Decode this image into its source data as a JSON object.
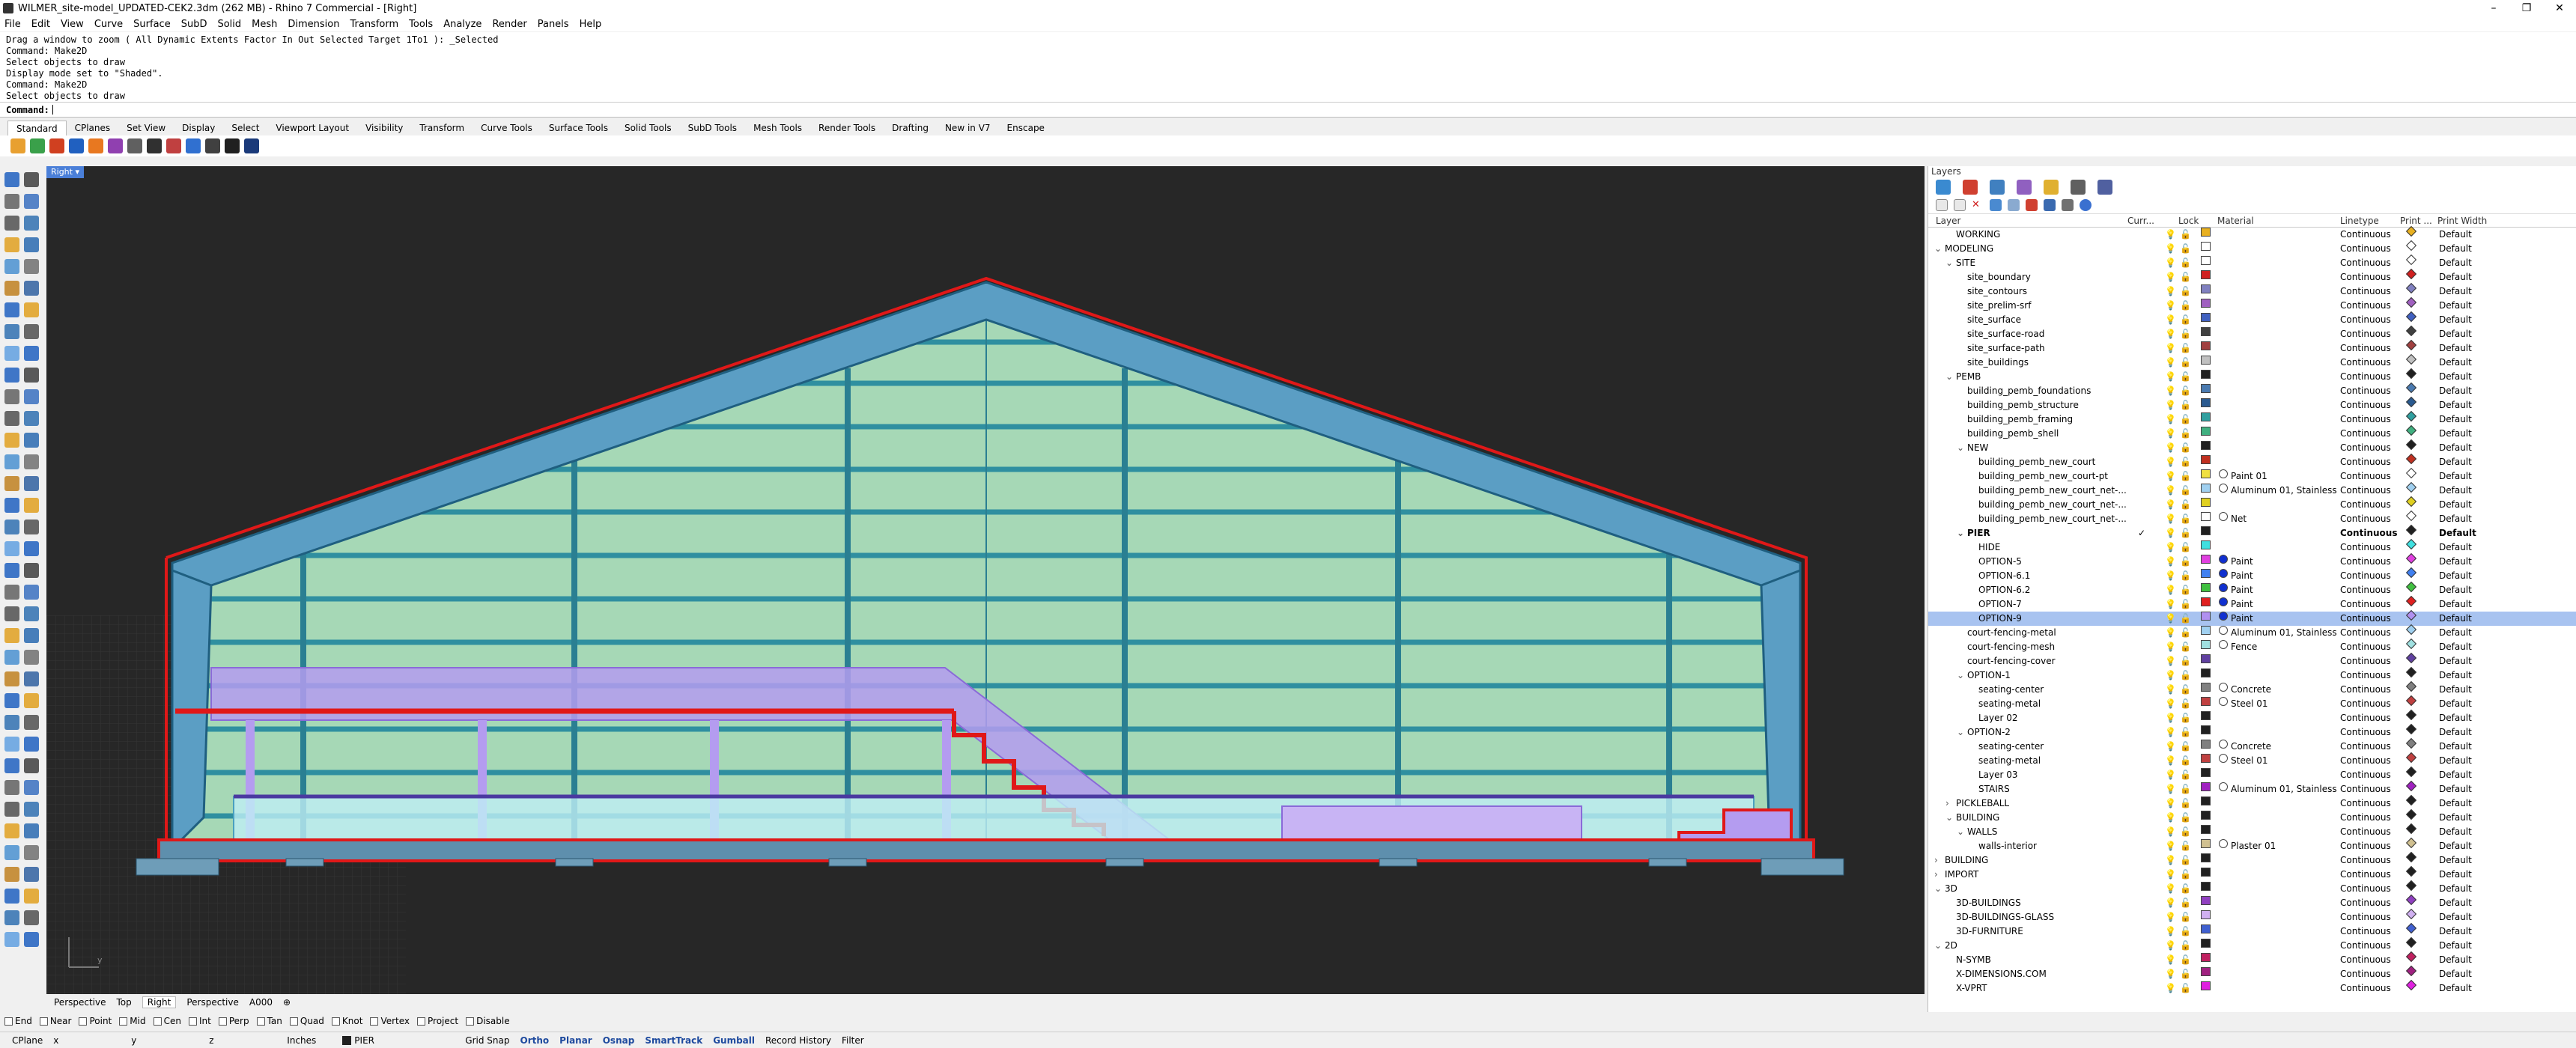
{
  "window": {
    "title": "WILMER_site-model_UPDATED-CEK2.3dm (262 MB) - Rhino 7 Commercial - [Right]",
    "min": "–",
    "max": "❐",
    "close": "✕"
  },
  "menu": [
    "File",
    "Edit",
    "View",
    "Curve",
    "Surface",
    "SubD",
    "Solid",
    "Mesh",
    "Dimension",
    "Transform",
    "Tools",
    "Analyze",
    "Render",
    "Panels",
    "Help"
  ],
  "command_history": [
    "Drag a window to zoom ( All  Dynamic  Extents  Factor  In  Out  Selected  Target  1To1 ): _Selected",
    "Command: Make2D",
    "Select objects to draw",
    "Display mode set to \"Shaded\".",
    "Command: Make2D",
    "Select objects to draw"
  ],
  "command_prompt": "Command:",
  "toolbar_tabs": [
    "Standard",
    "CPlanes",
    "Set View",
    "Display",
    "Select",
    "Viewport Layout",
    "Visibility",
    "Transform",
    "Curve Tools",
    "Surface Tools",
    "Solid Tools",
    "SubD Tools",
    "Mesh Tools",
    "Render Tools",
    "Drafting",
    "New in V7",
    "Enscape"
  ],
  "toolbar_icon_colors": [
    "#e8a030",
    "#3aa04a",
    "#d04020",
    "#2060c0",
    "#e87820",
    "#9040b0",
    "#606060",
    "#303030",
    "#c04040",
    "#3070d0",
    "#404040",
    "#202020",
    "#1a3a7a"
  ],
  "viewport": {
    "label": "Right",
    "label_arrow": "▾"
  },
  "viewport_tabs": [
    "Perspective",
    "Top",
    "Right",
    "Perspective",
    "A000",
    "⊕"
  ],
  "osnaps": [
    "End",
    "Near",
    "Point",
    "Mid",
    "Cen",
    "Int",
    "Perp",
    "Tan",
    "Quad",
    "Knot",
    "Vertex",
    "Project",
    "Disable"
  ],
  "status": {
    "cplane": "CPlane",
    "x": "x",
    "y": "y",
    "z": "z",
    "units": "Inches",
    "layer": "PIER",
    "grid_snap": "Grid Snap",
    "ortho": "Ortho",
    "planar": "Planar",
    "osnap": "Osnap",
    "smarttrack": "SmartTrack",
    "gumball": "Gumball",
    "record_history": "Record History",
    "filter": "Filter"
  },
  "layers_panel": {
    "title": "Layers",
    "columns": {
      "layer": "Layer",
      "current": "Curr...",
      "lock": "Lock",
      "material": "Material",
      "linetype": "Linetype",
      "print_color": "Print ...",
      "print_width": "Print Width"
    },
    "rows": [
      {
        "name": "WORKING",
        "level": 1,
        "expand": "",
        "color": "#e8b020",
        "material": "",
        "pc": "#e8b020",
        "linetype": "Continuous",
        "pw": "Default"
      },
      {
        "name": "MODELING",
        "level": 0,
        "expand": "⌄",
        "color": "#ffffff",
        "material": "",
        "pc": "#ffffff",
        "linetype": "Continuous",
        "pw": "Default"
      },
      {
        "name": "SITE",
        "level": 1,
        "expand": "⌄",
        "color": "#ffffff",
        "material": "",
        "pc": "#ffffff",
        "linetype": "Continuous",
        "pw": "Default"
      },
      {
        "name": "site_boundary",
        "level": 2,
        "expand": "",
        "color": "#d02020",
        "material": "",
        "pc": "#d02020",
        "linetype": "Continuous",
        "pw": "Default"
      },
      {
        "name": "site_contours",
        "level": 2,
        "expand": "",
        "color": "#8080c0",
        "material": "",
        "pc": "#8080c0",
        "linetype": "Continuous",
        "pw": "Default"
      },
      {
        "name": "site_prelim-srf",
        "level": 2,
        "expand": "",
        "color": "#a060c0",
        "material": "",
        "pc": "#a060c0",
        "linetype": "Continuous",
        "pw": "Default"
      },
      {
        "name": "site_surface",
        "level": 2,
        "expand": "",
        "color": "#4060c0",
        "material": "",
        "pc": "#4060c0",
        "linetype": "Continuous",
        "pw": "Default"
      },
      {
        "name": "site_surface-road",
        "level": 2,
        "expand": "",
        "color": "#404040",
        "material": "",
        "pc": "#404040",
        "linetype": "Continuous",
        "pw": "Default"
      },
      {
        "name": "site_surface-path",
        "level": 2,
        "expand": "",
        "color": "#a04040",
        "material": "",
        "pc": "#a04040",
        "linetype": "Continuous",
        "pw": "Default"
      },
      {
        "name": "site_buildings",
        "level": 2,
        "expand": "",
        "color": "#c0c0c0",
        "material": "",
        "pc": "#c0c0c0",
        "linetype": "Continuous",
        "pw": "Default"
      },
      {
        "name": "PEMB",
        "level": 1,
        "expand": "⌄",
        "color": "#202020",
        "material": "",
        "pc": "#202020",
        "linetype": "Continuous",
        "pw": "Default"
      },
      {
        "name": "building_pemb_foundations",
        "level": 2,
        "expand": "",
        "color": "#4a7ab0",
        "material": "",
        "pc": "#4a7ab0",
        "linetype": "Continuous",
        "pw": "Default"
      },
      {
        "name": "building_pemb_structure",
        "level": 2,
        "expand": "",
        "color": "#2a5a90",
        "material": "",
        "pc": "#2a5a90",
        "linetype": "Continuous",
        "pw": "Default"
      },
      {
        "name": "building_pemb_framing",
        "level": 2,
        "expand": "",
        "color": "#30a0a0",
        "material": "",
        "pc": "#30a0a0",
        "linetype": "Continuous",
        "pw": "Default"
      },
      {
        "name": "building_pemb_shell",
        "level": 2,
        "expand": "",
        "color": "#40b080",
        "material": "",
        "pc": "#40b080",
        "linetype": "Continuous",
        "pw": "Default"
      },
      {
        "name": "NEW",
        "level": 2,
        "expand": "⌄",
        "color": "#202020",
        "material": "",
        "pc": "#202020",
        "linetype": "Continuous",
        "pw": "Default"
      },
      {
        "name": "building_pemb_new_court",
        "level": 3,
        "expand": "",
        "color": "#c03020",
        "material": "",
        "pc": "#c03020",
        "linetype": "Continuous",
        "pw": "Default"
      },
      {
        "name": "building_pemb_new_court-pt",
        "level": 3,
        "expand": "",
        "color": "#f0e040",
        "material": "Paint 01",
        "pc": "#ffffff",
        "linetype": "Continuous",
        "pw": "Default"
      },
      {
        "name": "building_pemb_new_court_net-...",
        "level": 3,
        "expand": "",
        "color": "#a0d0f0",
        "material": "Aluminum 01, Stainless",
        "pc": "#a0d0f0",
        "linetype": "Continuous",
        "pw": "Default"
      },
      {
        "name": "building_pemb_new_court_net-...",
        "level": 3,
        "expand": "",
        "color": "#e0d020",
        "material": "",
        "pc": "#e0d020",
        "linetype": "Continuous",
        "pw": "Default"
      },
      {
        "name": "building_pemb_new_court_net-...",
        "level": 3,
        "expand": "",
        "color": "#ffffff",
        "material": "Net",
        "pc": "#ffffff",
        "linetype": "Continuous",
        "pw": "Default"
      },
      {
        "name": "PIER",
        "level": 2,
        "expand": "⌄",
        "color": "#202020",
        "material": "",
        "pc": "#202020",
        "linetype": "Continuous",
        "pw": "Default",
        "current": true
      },
      {
        "name": "HIDE",
        "level": 3,
        "expand": "",
        "color": "#40e0e0",
        "material": "",
        "pc": "#40e0e0",
        "linetype": "Continuous",
        "pw": "Default"
      },
      {
        "name": "OPTION-5",
        "level": 3,
        "expand": "",
        "color": "#e040e0",
        "material": "Paint",
        "pc": "#e040e0",
        "linetype": "Continuous",
        "pw": "Default",
        "blue": true
      },
      {
        "name": "OPTION-6.1",
        "level": 3,
        "expand": "",
        "color": "#4080f0",
        "material": "Paint",
        "pc": "#4080f0",
        "linetype": "Continuous",
        "pw": "Default",
        "blue": true
      },
      {
        "name": "OPTION-6.2",
        "level": 3,
        "expand": "",
        "color": "#40c040",
        "material": "Paint",
        "pc": "#40c040",
        "linetype": "Continuous",
        "pw": "Default",
        "blue": true
      },
      {
        "name": "OPTION-7",
        "level": 3,
        "expand": "",
        "color": "#e02020",
        "material": "Paint",
        "pc": "#e02020",
        "linetype": "Continuous",
        "pw": "Default",
        "blue": true
      },
      {
        "name": "OPTION-9",
        "level": 3,
        "expand": "",
        "color": "#b090f0",
        "material": "Paint",
        "pc": "#b090f0",
        "linetype": "Continuous",
        "pw": "Default",
        "blue": true,
        "selected": true
      },
      {
        "name": "court-fencing-metal",
        "level": 2,
        "expand": "",
        "color": "#a0d0f0",
        "material": "Aluminum 01, Stainless",
        "pc": "#a0d0f0",
        "linetype": "Continuous",
        "pw": "Default"
      },
      {
        "name": "court-fencing-mesh",
        "level": 2,
        "expand": "",
        "color": "#a0e0e0",
        "material": "Fence",
        "pc": "#a0e0e0",
        "linetype": "Continuous",
        "pw": "Default"
      },
      {
        "name": "court-fencing-cover",
        "level": 2,
        "expand": "",
        "color": "#6040a0",
        "material": "",
        "pc": "#6040a0",
        "linetype": "Continuous",
        "pw": "Default"
      },
      {
        "name": "OPTION-1",
        "level": 2,
        "expand": "⌄",
        "color": "#202020",
        "material": "",
        "pc": "#202020",
        "linetype": "Continuous",
        "pw": "Default"
      },
      {
        "name": "seating-center",
        "level": 3,
        "expand": "",
        "color": "#808080",
        "material": "Concrete",
        "pc": "#808080",
        "linetype": "Continuous",
        "pw": "Default"
      },
      {
        "name": "seating-metal",
        "level": 3,
        "expand": "",
        "color": "#c04040",
        "material": "Steel 01",
        "pc": "#c04040",
        "linetype": "Continuous",
        "pw": "Default"
      },
      {
        "name": "Layer 02",
        "level": 3,
        "expand": "",
        "color": "#202020",
        "material": "",
        "pc": "#202020",
        "linetype": "Continuous",
        "pw": "Default"
      },
      {
        "name": "OPTION-2",
        "level": 2,
        "expand": "⌄",
        "color": "#202020",
        "material": "",
        "pc": "#202020",
        "linetype": "Continuous",
        "pw": "Default"
      },
      {
        "name": "seating-center",
        "level": 3,
        "expand": "",
        "color": "#808080",
        "material": "Concrete",
        "pc": "#808080",
        "linetype": "Continuous",
        "pw": "Default"
      },
      {
        "name": "seating-metal",
        "level": 3,
        "expand": "",
        "color": "#c04040",
        "material": "Steel 01",
        "pc": "#c04040",
        "linetype": "Continuous",
        "pw": "Default"
      },
      {
        "name": "Layer 03",
        "level": 3,
        "expand": "",
        "color": "#202020",
        "material": "",
        "pc": "#202020",
        "linetype": "Continuous",
        "pw": "Default"
      },
      {
        "name": "STAIRS",
        "level": 3,
        "expand": "",
        "color": "#a020c0",
        "material": "Aluminum 01, Stainless",
        "pc": "#a020c0",
        "linetype": "Continuous",
        "pw": "Default"
      },
      {
        "name": "PICKLEBALL",
        "level": 1,
        "expand": "›",
        "color": "#202020",
        "material": "",
        "pc": "#202020",
        "linetype": "Continuous",
        "pw": "Default"
      },
      {
        "name": "BUILDING",
        "level": 1,
        "expand": "⌄",
        "color": "#202020",
        "material": "",
        "pc": "#202020",
        "linetype": "Continuous",
        "pw": "Default"
      },
      {
        "name": "WALLS",
        "level": 2,
        "expand": "⌄",
        "color": "#202020",
        "material": "",
        "pc": "#202020",
        "linetype": "Continuous",
        "pw": "Default"
      },
      {
        "name": "walls-interior",
        "level": 3,
        "expand": "",
        "color": "#d0c090",
        "material": "Plaster 01",
        "pc": "#d0c090",
        "linetype": "Continuous",
        "pw": "Default"
      },
      {
        "name": "BUILDING",
        "level": 0,
        "expand": "›",
        "color": "#202020",
        "material": "",
        "pc": "#202020",
        "linetype": "Continuous",
        "pw": "Default"
      },
      {
        "name": "IMPORT",
        "level": 0,
        "expand": "›",
        "color": "#202020",
        "material": "",
        "pc": "#202020",
        "linetype": "Continuous",
        "pw": "Default"
      },
      {
        "name": "3D",
        "level": 0,
        "expand": "⌄",
        "color": "#202020",
        "material": "",
        "pc": "#202020",
        "linetype": "Continuous",
        "pw": "Default"
      },
      {
        "name": "3D-BUILDINGS",
        "level": 1,
        "expand": "",
        "color": "#9040c0",
        "material": "",
        "pc": "#9040c0",
        "linetype": "Continuous",
        "pw": "Default"
      },
      {
        "name": "3D-BUILDINGS-GLASS",
        "level": 1,
        "expand": "",
        "color": "#d0b0f0",
        "material": "",
        "pc": "#d0b0f0",
        "linetype": "Continuous",
        "pw": "Default"
      },
      {
        "name": "3D-FURNITURE",
        "level": 1,
        "expand": "",
        "color": "#4060d0",
        "material": "",
        "pc": "#4060d0",
        "linetype": "Continuous",
        "pw": "Default"
      },
      {
        "name": "2D",
        "level": 0,
        "expand": "⌄",
        "color": "#202020",
        "material": "",
        "pc": "#202020",
        "linetype": "Continuous",
        "pw": "Default"
      },
      {
        "name": "N-SYMB",
        "level": 1,
        "expand": "",
        "color": "#c02060",
        "material": "",
        "pc": "#c02060",
        "linetype": "Continuous",
        "pw": "Default"
      },
      {
        "name": "X-DIMENSIONS.COM",
        "level": 1,
        "expand": "",
        "color": "#a02080",
        "material": "",
        "pc": "#a02080",
        "linetype": "Continuous",
        "pw": "Default"
      },
      {
        "name": "X-VPRT",
        "level": 1,
        "expand": "",
        "color": "#e020e0",
        "material": "",
        "pc": "#e020e0",
        "linetype": "Continuous",
        "pw": "Default"
      }
    ]
  }
}
